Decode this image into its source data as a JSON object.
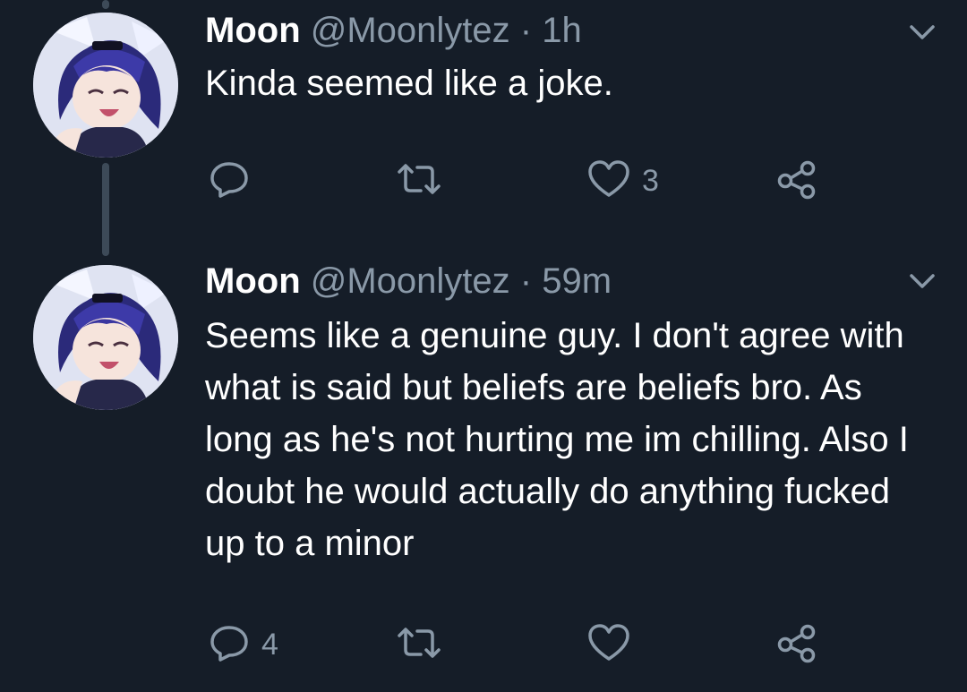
{
  "tweets": [
    {
      "name": "Moon",
      "handle": "@Moonlytez",
      "separator": "·",
      "time": "1h",
      "text": "Kinda seemed like a joke.",
      "replies": "",
      "retweets": "",
      "likes": "3"
    },
    {
      "name": "Moon",
      "handle": "@Moonlytez",
      "separator": "·",
      "time": "59m",
      "text": "Seems like a genuine guy. I don't agree with what is said but beliefs are beliefs bro. As long as he's not hurting me im chilling. Also I doubt he would actually do anything fucked up to a minor",
      "replies": "4",
      "retweets": "",
      "likes": ""
    }
  ],
  "icons": {
    "reply": "reply-icon",
    "retweet": "retweet-icon",
    "like": "heart-icon",
    "share": "share-icon",
    "menu": "chevron-down-icon"
  },
  "colors": {
    "background": "#151d28",
    "secondary_text": "#8a99a8",
    "thread_line": "#3d4a58"
  }
}
